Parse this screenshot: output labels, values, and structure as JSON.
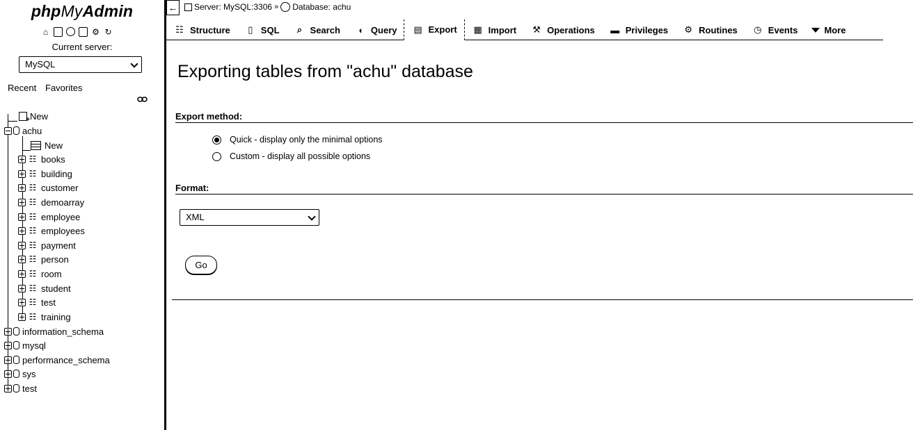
{
  "nav": {
    "logo_php": "php",
    "logo_my": "My",
    "logo_admin": "Admin",
    "icons": [
      "home-icon",
      "exit-icon",
      "help-icon",
      "docs-icon",
      "settings-icon",
      "reload-icon"
    ],
    "current_server_label": "Current server:",
    "server_select": "MySQL",
    "recent": "Recent",
    "favorites": "Favorites",
    "tree": {
      "new": "New",
      "db_achu": "achu",
      "achu_new": "New",
      "tables": [
        "books",
        "building",
        "customer",
        "demoarray",
        "employee",
        "employees",
        "payment",
        "person",
        "room",
        "student",
        "test",
        "training"
      ],
      "databases": [
        "information_schema",
        "mysql",
        "performance_schema",
        "sys",
        "test"
      ]
    }
  },
  "breadcrumb": {
    "server": "Server: MySQL:3306",
    "database": "Database: achu"
  },
  "tabs": [
    {
      "label": "Structure",
      "icon": "structure-icon"
    },
    {
      "label": "SQL",
      "icon": "sql-icon"
    },
    {
      "label": "Search",
      "icon": "search-icon"
    },
    {
      "label": "Query",
      "icon": "query-icon"
    },
    {
      "label": "Export",
      "icon": "export-icon"
    },
    {
      "label": "Import",
      "icon": "import-icon"
    },
    {
      "label": "Operations",
      "icon": "operations-icon"
    },
    {
      "label": "Privileges",
      "icon": "privileges-icon"
    },
    {
      "label": "Routines",
      "icon": "routines-icon"
    },
    {
      "label": "Events",
      "icon": "events-icon"
    },
    {
      "label": "More",
      "icon": "caret-down-icon"
    }
  ],
  "main": {
    "title": "Exporting tables from \"achu\" database",
    "export_method_label": "Export method:",
    "quick_option": "Quick - display only the minimal options",
    "custom_option": "Custom - display all possible options",
    "format_label": "Format:",
    "format_value": "XML",
    "go_label": "Go"
  }
}
